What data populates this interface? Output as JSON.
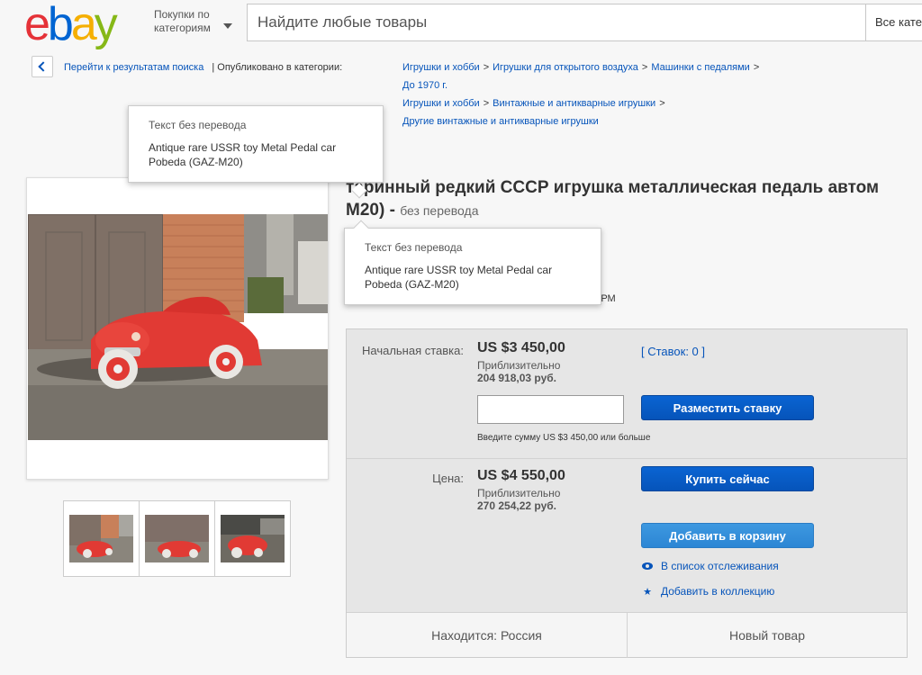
{
  "header": {
    "logo_letters": [
      "e",
      "b",
      "a",
      "y"
    ],
    "categories_line1": "Покупки по",
    "categories_line2": "категориям",
    "search_placeholder": "Найдите любые товары",
    "search_category": "Все категории"
  },
  "breadcrumb": {
    "back_label": "Перейти к результатам поиска",
    "published_label": "| Опубликовано в категории:",
    "path1": [
      "Игрушки и хобби",
      "Игрушки для открытого воздуха",
      "Машинки с педалями",
      "До 1970 г."
    ],
    "path2": [
      "Игрушки и хобби",
      "Винтажные и антикварные игрушки",
      "Другие винтажные и антикварные игрушки"
    ]
  },
  "tooltip": {
    "title": "Текст без перевода",
    "text_line1": "Antique rare USSR toy Metal Pedal car",
    "text_line2": "Pobeda (GAZ-M20)"
  },
  "item": {
    "title_line1": "таринный редкий СССР игрушка металлическая педаль автом",
    "title_line2": "M20) -",
    "no_translation": "без перевода",
    "time_fragment": "ВРМ"
  },
  "gallery": {
    "thumbnail_count": 3
  },
  "buybox": {
    "start_bid_label": "Начальная ставка:",
    "start_bid_price": "US $3 450,00",
    "approx_label": "Приблизительно",
    "start_bid_rub": "204 918,03 руб.",
    "bids_link": "[ Ставок: 0 ]",
    "place_bid_button": "Разместить ставку",
    "bid_hint": "Введите сумму US $3 450,00 или больше",
    "price_label": "Цена:",
    "price": "US $4 550,00",
    "price_rub": "270 254,22 руб.",
    "buy_now_button": "Купить сейчас",
    "add_to_cart_button": "Добавить в корзину",
    "watchlist_link": "В список отслеживания",
    "collection_link": "Добавить в коллекцию",
    "location": "Находится: Россия",
    "condition": "Новый товар"
  },
  "colors": {
    "ebay_red": "#e53238",
    "ebay_blue": "#0064d2",
    "ebay_yellow": "#f5af02",
    "ebay_green": "#86b817",
    "link_blue": "#0654ba",
    "button_blue": "#0654ba",
    "button_light_blue": "#2c86d4"
  }
}
